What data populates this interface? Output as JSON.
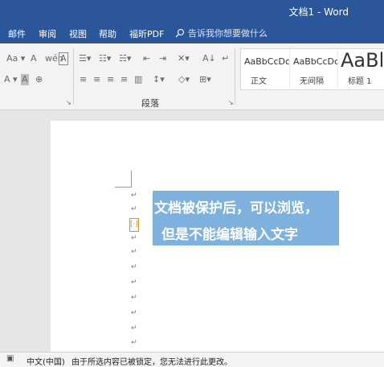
{
  "window": {
    "title": "文档1 - Word"
  },
  "menu": {
    "items": [
      "邮件",
      "审阅",
      "视图",
      "帮助",
      "福昕PDF"
    ],
    "tell_me": "告诉我你想要做什么"
  },
  "ribbon": {
    "group_paragraph": "段落",
    "styles": [
      {
        "sample": "AaBbCcDc",
        "name": "正文"
      },
      {
        "sample": "AaBbCcDc",
        "name": "无间隔"
      },
      {
        "sample": "AaBl",
        "name": "标题 1"
      }
    ]
  },
  "document": {
    "overlay_line1": "文档被保护后，可以浏览，",
    "overlay_line2": "但是不能编辑输入文字",
    "paragraph_mark": "↵",
    "bracket_mark": "[·]"
  },
  "status": {
    "language": "中文(中国)",
    "message": "由于所选内容已被锁定，您无法进行此更改。"
  },
  "colors": {
    "accent": "#2b579a",
    "overlay": "#7fb1de"
  }
}
